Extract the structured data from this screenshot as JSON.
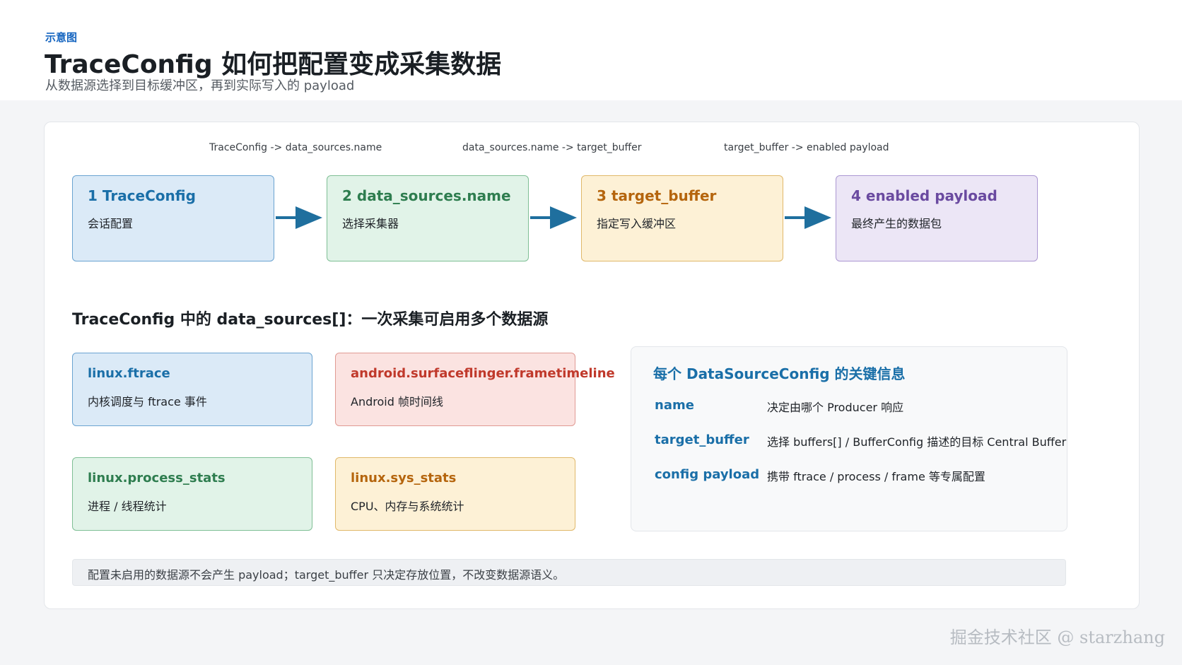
{
  "header": {
    "kicker": "示意图",
    "title": "TraceConfig 如何把配置变成采集数据",
    "subtitle": "从数据源选择到目标缓冲区，再到实际写入的 payload"
  },
  "flow": {
    "edge_labels": [
      "TraceConfig -> data_sources.name",
      "data_sources.name -> target_buffer",
      "target_buffer -> enabled payload"
    ],
    "stages": [
      {
        "title": "1 TraceConfig",
        "desc": "会话配置",
        "color": "#1a6fa8",
        "bg": "#dbeaf7",
        "border": "#6aa3d1"
      },
      {
        "title": "2 data_sources.name",
        "desc": "选择采集器",
        "color": "#2e7d4f",
        "bg": "#e1f3e8",
        "border": "#7fbf95"
      },
      {
        "title": "3 target_buffer",
        "desc": "指定写入缓冲区",
        "color": "#b5650d",
        "bg": "#fdf1d6",
        "border": "#e0b86a"
      },
      {
        "title": "4 enabled payload",
        "desc": "最终产生的数据包",
        "color": "#6a4aa0",
        "bg": "#ece6f6",
        "border": "#ab97d2"
      }
    ],
    "arrow_color": "#1f6f9e"
  },
  "sources": {
    "heading": "TraceConfig 中的 data_sources[]：一次采集可启用多个数据源",
    "items": [
      {
        "name": "linux.ftrace",
        "desc": "内核调度与 ftrace 事件",
        "color": "#1a6fa8",
        "bg": "#dbeaf7",
        "border": "#6aa3d1"
      },
      {
        "name": "android.surfaceflinger.frametimeline",
        "desc": "Android 帧时间线",
        "color": "#c0392b",
        "bg": "#fbe3e1",
        "border": "#e09a93"
      },
      {
        "name": "linux.process_stats",
        "desc": "进程 / 线程统计",
        "color": "#2e7d4f",
        "bg": "#e1f3e8",
        "border": "#7fbf95"
      },
      {
        "name": "linux.sys_stats",
        "desc": "CPU、内存与系统统计",
        "color": "#b5650d",
        "bg": "#fdf1d6",
        "border": "#e0b86a"
      }
    ]
  },
  "info": {
    "title": "每个 DataSourceConfig 的关键信息",
    "rows": [
      {
        "key": "name",
        "value": "决定由哪个 Producer 响应"
      },
      {
        "key": "target_buffer",
        "value": "选择 buffers[] / BufferConfig 描述的目标 Central Buffer"
      },
      {
        "key": "config payload",
        "value": "携带 ftrace / process / frame 等专属配置"
      }
    ]
  },
  "note": "配置未启用的数据源不会产生 payload；target_buffer 只决定存放位置，不改变数据源语义。",
  "watermark": "掘金技术社区 @ starzhang"
}
